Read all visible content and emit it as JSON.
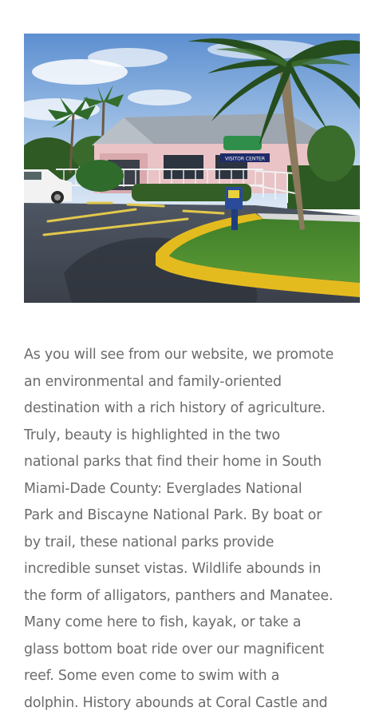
{
  "image": {
    "sign_text": "VISITOR CENTER"
  },
  "article": {
    "lines": [
      "As you will see from our website, we promote",
      "an environmental and family-oriented",
      "destination with a rich history of agriculture.",
      "Truly, beauty is highlighted in the two",
      "national parks that find their home in South",
      "Miami-Dade County: Everglades National",
      "Park and Biscayne National Park. By boat or",
      "by trail, these national parks provide",
      "incredible sunset vistas. Wildlife abounds in",
      "the form of alligators, panthers and Manatee.",
      "Many come here to fish, kayak, or take a",
      "glass bottom boat ride over our magnificent",
      "reef. Some even come to swim with a",
      "dolphin. History abounds at Coral Castle and"
    ]
  }
}
